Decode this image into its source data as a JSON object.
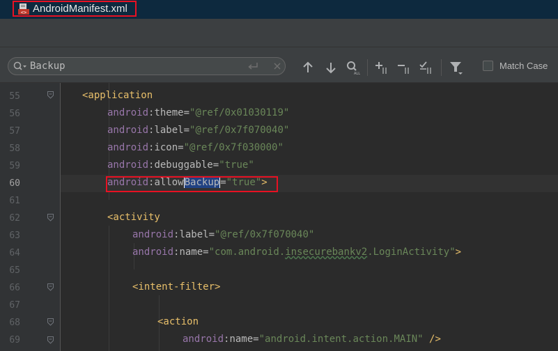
{
  "tab": {
    "title": "AndroidManifest.xml",
    "icon": "xml-file-icon"
  },
  "find": {
    "query": "Backup",
    "match_case_label": "Match Case",
    "match_case_checked": false,
    "buttons": [
      "previous-occurrence",
      "next-occurrence",
      "find-all",
      "add-selection",
      "remove-selection",
      "select-all-occurrences",
      "filter"
    ]
  },
  "editor": {
    "current_line": "60",
    "lines": [
      {
        "num": "55",
        "text": "<application"
      },
      {
        "num": "56",
        "ns": "android",
        "attr": "theme",
        "val": "\"@ref/0x01030119\""
      },
      {
        "num": "57",
        "ns": "android",
        "attr": "label",
        "val": "\"@ref/0x7f070040\""
      },
      {
        "num": "58",
        "ns": "android",
        "attr": "icon",
        "val": "\"@ref/0x7f030000\""
      },
      {
        "num": "59",
        "ns": "android",
        "attr": "debuggable",
        "val": "\"true\""
      },
      {
        "num": "60",
        "ns": "android",
        "attr_pre": "allow",
        "attr_match": "Backup",
        "val": "\"true\"",
        "close": ">"
      },
      {
        "num": "61"
      },
      {
        "num": "62",
        "text": "<activity"
      },
      {
        "num": "63",
        "ns": "android",
        "attr": "label",
        "val": "\"@ref/0x7f070040\""
      },
      {
        "num": "64",
        "ns": "android",
        "attr": "name",
        "val_a": "\"com.android.",
        "val_b": "insecurebankv2",
        "val_c": ".LoginActivity\"",
        "close": ">"
      },
      {
        "num": "65"
      },
      {
        "num": "66",
        "text": "<intent-filter>"
      },
      {
        "num": "67"
      },
      {
        "num": "68",
        "text": "<action"
      },
      {
        "num": "69",
        "ns": "android",
        "attr": "name",
        "val": "\"android.intent.action.MAIN\"",
        "close": " />"
      }
    ]
  },
  "colors": {
    "tag": "#e8bf6a",
    "namespace": "#9876aa",
    "attribute": "#bababa",
    "string": "#6a8759",
    "annotation_box": "#e81123",
    "search_match": "#214283"
  }
}
